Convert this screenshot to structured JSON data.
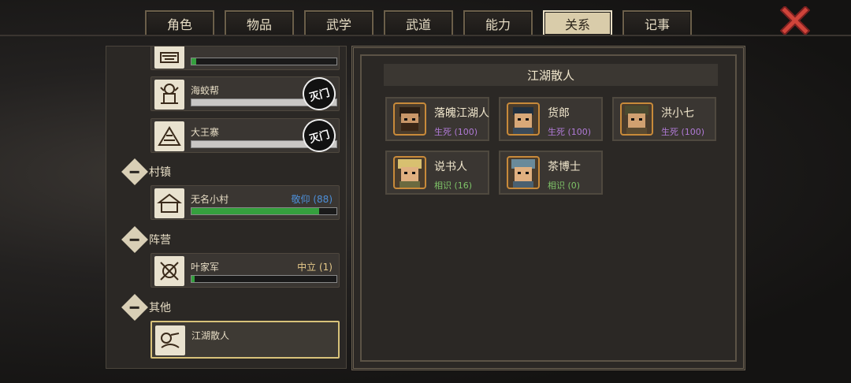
{
  "tabs": [
    {
      "label": "角色"
    },
    {
      "label": "物品"
    },
    {
      "label": "武学"
    },
    {
      "label": "武道"
    },
    {
      "label": "能力"
    },
    {
      "label": "关系"
    },
    {
      "label": "记事"
    }
  ],
  "active_tab": "关系",
  "sidebar": {
    "factions": [
      {
        "name": "",
        "relation": "",
        "progress": 0.02,
        "destroyed": false
      },
      {
        "name": "海蛟帮",
        "relation": "",
        "progress": 0.0,
        "destroyed": true,
        "stamp": "灭门"
      },
      {
        "name": "大王寨",
        "relation": "",
        "progress": 0.0,
        "destroyed": true,
        "stamp": "灭门"
      }
    ],
    "groups": [
      {
        "label": "村镇",
        "items": [
          {
            "name": "无名小村",
            "relation": "敬仰 (88)",
            "relation_color": "#4d8fd8",
            "progress": 0.88
          }
        ]
      },
      {
        "label": "阵营",
        "items": [
          {
            "name": "叶家军",
            "relation": "中立 (1)",
            "relation_color": "#e6c98a",
            "progress": 0.01
          }
        ]
      },
      {
        "label": "其他",
        "items": [
          {
            "name": "江湖散人",
            "relation": "",
            "selected": true
          }
        ]
      }
    ]
  },
  "main": {
    "section_title": "江湖散人",
    "npcs": [
      {
        "name": "落魄江湖人",
        "relation": "生死 (100)",
        "color": "purple"
      },
      {
        "name": "货郎",
        "relation": "生死 (100)",
        "color": "purple"
      },
      {
        "name": "洪小七",
        "relation": "生死 (100)",
        "color": "purple"
      },
      {
        "name": "说书人",
        "relation": "相识 (16)",
        "color": "green"
      },
      {
        "name": "茶博士",
        "relation": "相识 (0)",
        "color": "green"
      }
    ]
  },
  "colors": {
    "accent": "#d8c27a",
    "purple": "#b07ad6",
    "green": "#7ec468",
    "blue": "#4d8fd8"
  }
}
